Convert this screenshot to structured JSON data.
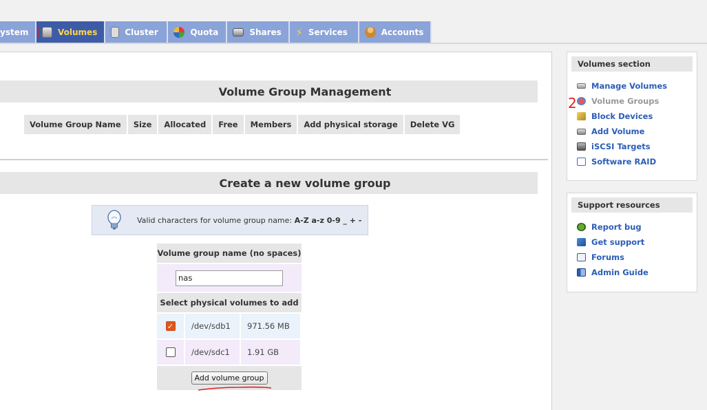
{
  "tabs": [
    {
      "label": "ystem",
      "icon": "system-icon",
      "active": false
    },
    {
      "label": "Volumes",
      "icon": "volumes-icon",
      "active": true
    },
    {
      "label": "Cluster",
      "icon": "cluster-icon",
      "active": false
    },
    {
      "label": "Quota",
      "icon": "quota-icon",
      "active": false
    },
    {
      "label": "Shares",
      "icon": "shares-icon",
      "active": false
    },
    {
      "label": "Services",
      "icon": "services-icon",
      "active": false
    },
    {
      "label": "Accounts",
      "icon": "accounts-icon",
      "active": false
    }
  ],
  "vg_management": {
    "title": "Volume Group Management",
    "columns": [
      "Volume Group Name",
      "Size",
      "Allocated",
      "Free",
      "Members",
      "Add physical storage",
      "Delete VG"
    ]
  },
  "create_vg": {
    "title": "Create a new volume group",
    "info_text": "Valid characters for volume group name: ",
    "info_chars": "A-Z a-z 0-9 _ + -",
    "name_label": "Volume group name (no spaces)",
    "name_value": "nas",
    "select_label": "Select physical volumes to add",
    "physical_volumes": [
      {
        "device": "/dev/sdb1",
        "size": "971.56 MB",
        "checked": true
      },
      {
        "device": "/dev/sdc1",
        "size": "1.91 GB",
        "checked": false
      }
    ],
    "submit_label": "Add volume group"
  },
  "sidebar": {
    "volumes_section": {
      "title": "Volumes section",
      "items": [
        {
          "label": "Manage Volumes",
          "icon": "disk-icon",
          "current": false
        },
        {
          "label": "Volume Groups",
          "icon": "volume-groups-icon",
          "current": true
        },
        {
          "label": "Block Devices",
          "icon": "block-devices-icon",
          "current": false
        },
        {
          "label": "Add Volume",
          "icon": "add-volume-icon",
          "current": false
        },
        {
          "label": "iSCSI Targets",
          "icon": "iscsi-icon",
          "current": false
        },
        {
          "label": "Software RAID",
          "icon": "raid-icon",
          "current": false
        }
      ]
    },
    "support": {
      "title": "Support resources",
      "items": [
        {
          "label": "Report bug",
          "icon": "bug-icon"
        },
        {
          "label": "Get support",
          "icon": "support-icon"
        },
        {
          "label": "Forums",
          "icon": "forums-icon"
        },
        {
          "label": "Admin Guide",
          "icon": "guide-icon"
        }
      ]
    }
  },
  "annotations": {
    "step_number": "2"
  },
  "colors": {
    "tab": "#8aa3d8",
    "tab_active": "#3d5ca8",
    "tab_active_text": "#ffd54a",
    "link": "#2b5db8",
    "checkbox_checked": "#e0571c",
    "annotation": "#e02020"
  }
}
